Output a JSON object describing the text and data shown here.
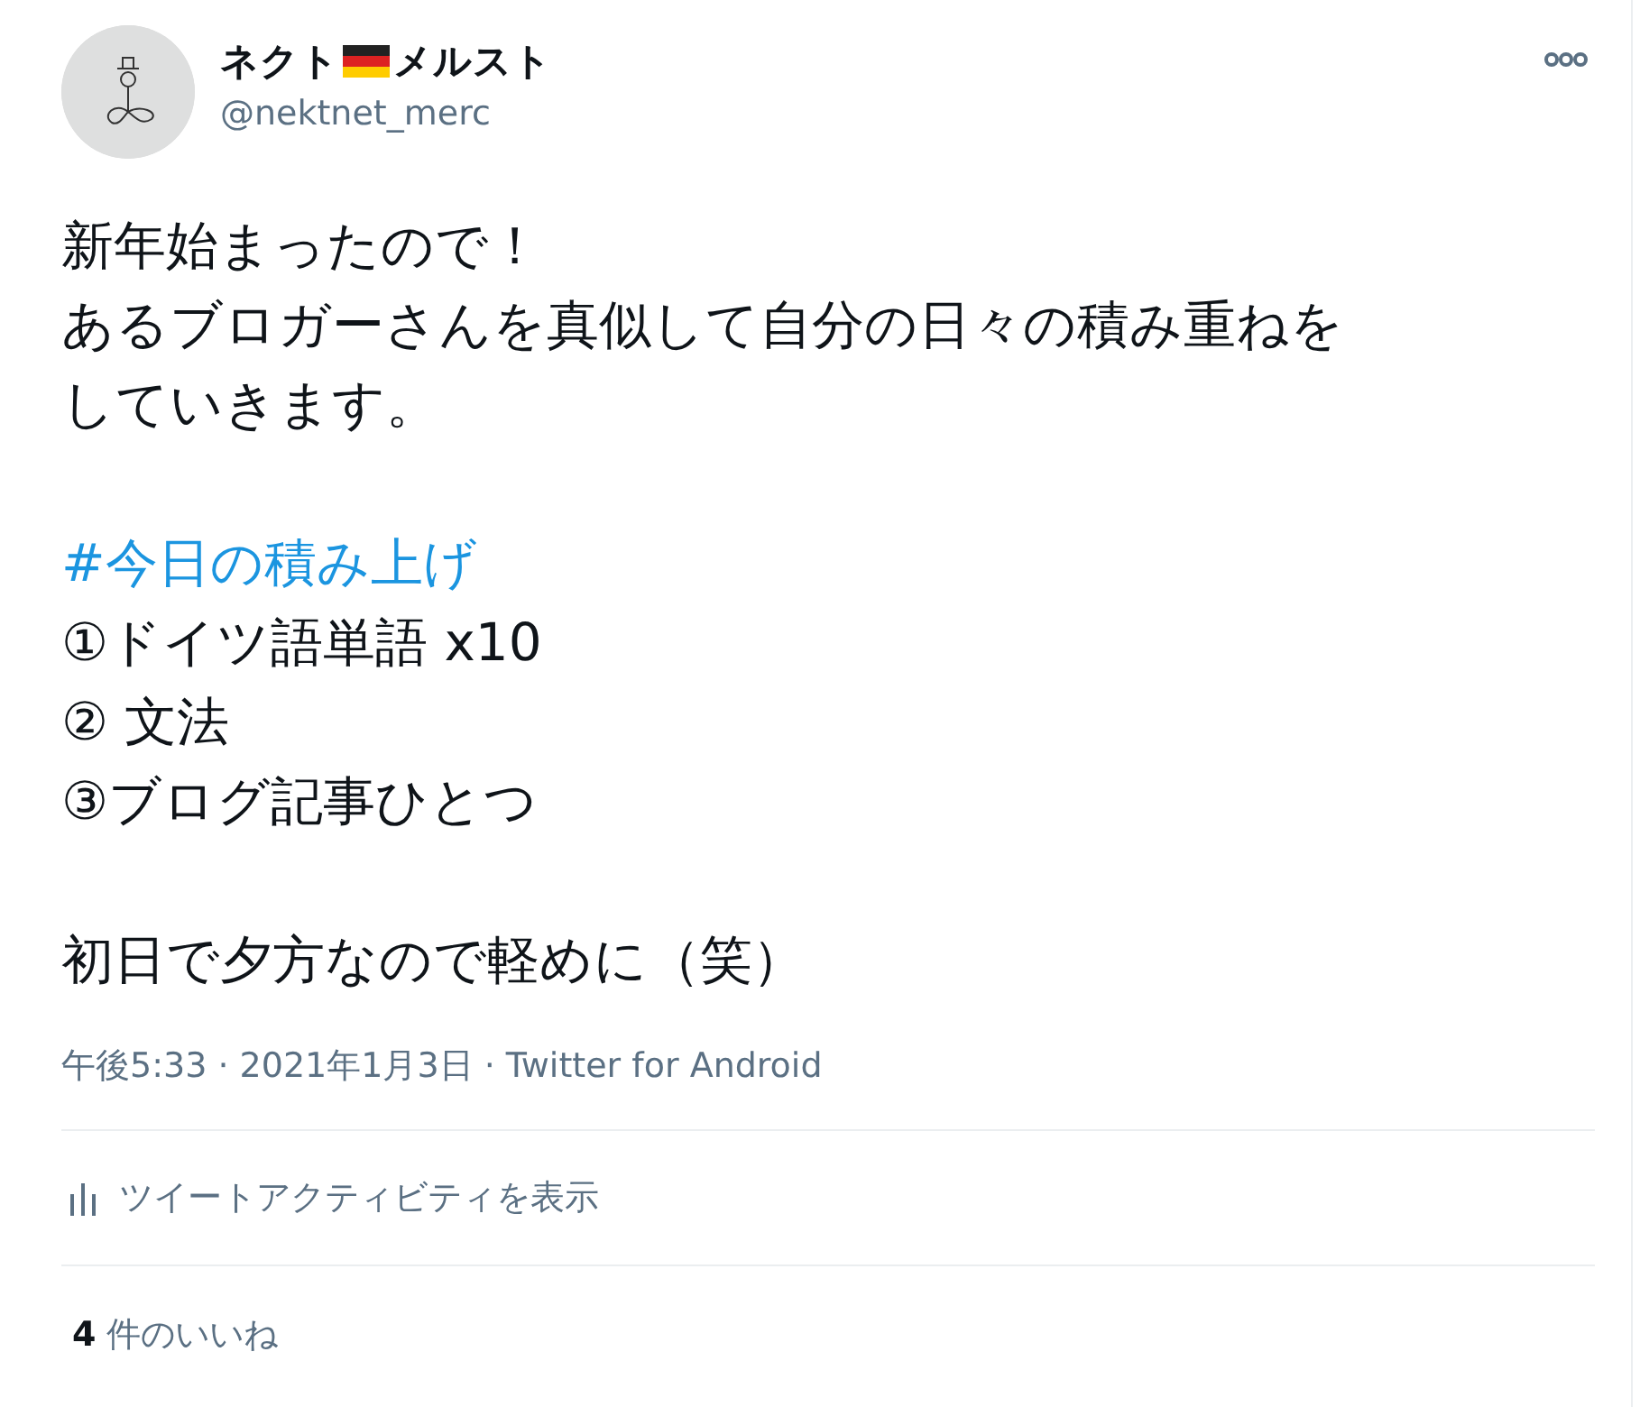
{
  "author": {
    "name_before": "ネクト",
    "name_after": "メルスト",
    "handle": "@nektnet_merc"
  },
  "paragraphs": [
    {
      "lines": [
        {
          "kind": "text",
          "text": "新年始まったので！"
        },
        {
          "kind": "text",
          "text": "あるブロガーさんを真似して自分の日々の積み重ねを"
        },
        {
          "kind": "text",
          "text": "していきます。"
        }
      ]
    },
    {
      "lines": [
        {
          "kind": "hashtag",
          "text": "#今日の積み上げ"
        },
        {
          "kind": "text",
          "text": "①ドイツ語単語 x10"
        },
        {
          "kind": "text",
          "text": "② 文法"
        },
        {
          "kind": "text",
          "text": "③ブログ記事ひとつ"
        }
      ]
    },
    {
      "lines": [
        {
          "kind": "text",
          "text": "初日で夕方なので軽めに（笑）"
        }
      ]
    }
  ],
  "meta": "午後5:33 · 2021年1月3日 · Twitter for Android",
  "activity": "ツイートアクティビティを表示",
  "likes": {
    "count": "4",
    "label": "件のいいね"
  }
}
